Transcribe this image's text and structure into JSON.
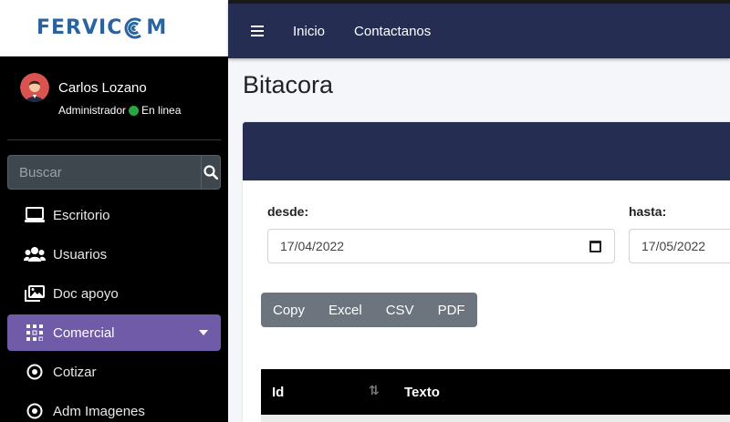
{
  "brand": {
    "name_left": "FERVIC",
    "name_right": "M"
  },
  "user": {
    "name": "Carlos Lozano",
    "role": "Administrador",
    "status": "En linea"
  },
  "search": {
    "placeholder": "Buscar"
  },
  "nav": {
    "items": [
      {
        "label": "Escritorio",
        "icon": "desktop-icon"
      },
      {
        "label": "Usuarios",
        "icon": "users-icon"
      },
      {
        "label": "Doc apoyo",
        "icon": "images-icon"
      },
      {
        "label": "Comercial",
        "icon": "grid-icon",
        "active": true
      },
      {
        "label": "Cotizar",
        "icon": "disc-icon"
      },
      {
        "label": "Adm Imagenes",
        "icon": "disc-icon"
      }
    ]
  },
  "topbar": {
    "links": [
      "Inicio",
      "Contactanos"
    ]
  },
  "page": {
    "title": "Bitacora"
  },
  "filters": {
    "from_label": "desde:",
    "from_value": "17/04/2022",
    "to_label": "hasta:",
    "to_value": "17/05/2022"
  },
  "export_buttons": [
    "Copy",
    "Excel",
    "CSV",
    "PDF"
  ],
  "table": {
    "columns": [
      "Id",
      "Texto"
    ]
  },
  "colors": {
    "sidebar": "#000000",
    "navbar": "#252d52",
    "active": "#6f5ba8",
    "online": "#28a745",
    "brand": "#2a64a0"
  }
}
